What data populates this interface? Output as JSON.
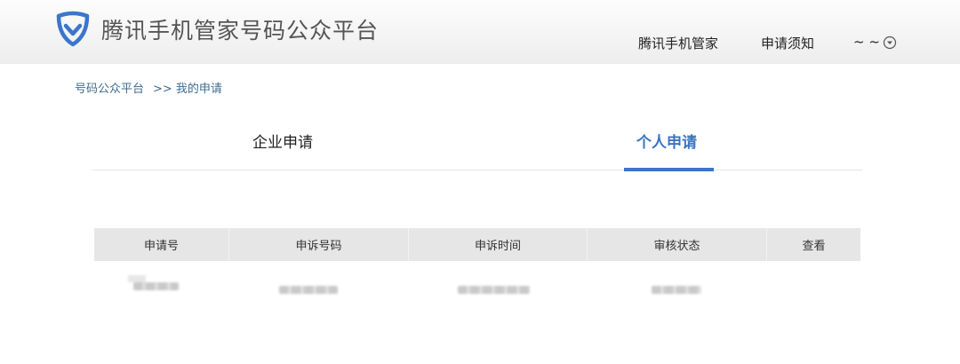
{
  "header": {
    "brand_title": "腾讯手机管家号码公众平台",
    "brand_color": "#3a76cc",
    "nav": [
      "腾讯手机管家",
      "申请须知"
    ],
    "user_name": "~ ~",
    "dropdown_icon": "circle-chevron-down-icon"
  },
  "breadcrumb": {
    "home": "号码公众平台",
    "separator": ">>",
    "current": "我的申请"
  },
  "tabs": [
    {
      "label": "企业申请",
      "active": false
    },
    {
      "label": "个人申请",
      "active": true
    }
  ],
  "table": {
    "columns": [
      "申请号",
      "申诉号码",
      "申诉时间",
      "审核状态",
      "查看"
    ],
    "rows": [
      {
        "note": "cell values are blurred/redacted in the screenshot"
      }
    ]
  }
}
